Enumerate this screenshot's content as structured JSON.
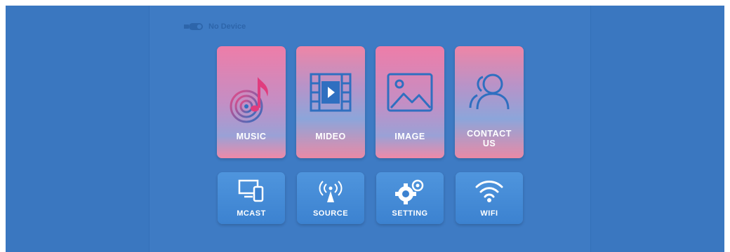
{
  "status": {
    "device_label": "No Device"
  },
  "main_tiles": [
    {
      "label": "MUSIC",
      "icon": "music-note-icon"
    },
    {
      "label": "MIDEO",
      "icon": "video-film-icon"
    },
    {
      "label": "IMAGE",
      "icon": "image-landscape-icon"
    },
    {
      "label": "CONTACT US",
      "icon": "contact-users-icon"
    }
  ],
  "small_tiles": [
    {
      "label": "MCAST",
      "icon": "screen-mirror-icon"
    },
    {
      "label": "SOURCE",
      "icon": "antenna-broadcast-icon"
    },
    {
      "label": "SETTING",
      "icon": "gears-icon"
    },
    {
      "label": "WIFI",
      "icon": "wifi-icon"
    }
  ],
  "colors": {
    "background": "#3a77c0",
    "panel": "#3e7bc4",
    "tile_blue": "#5a90d4",
    "tile_pink": "#ee7da8",
    "small_tile": "#4a8fda",
    "text": "#ffffff"
  }
}
